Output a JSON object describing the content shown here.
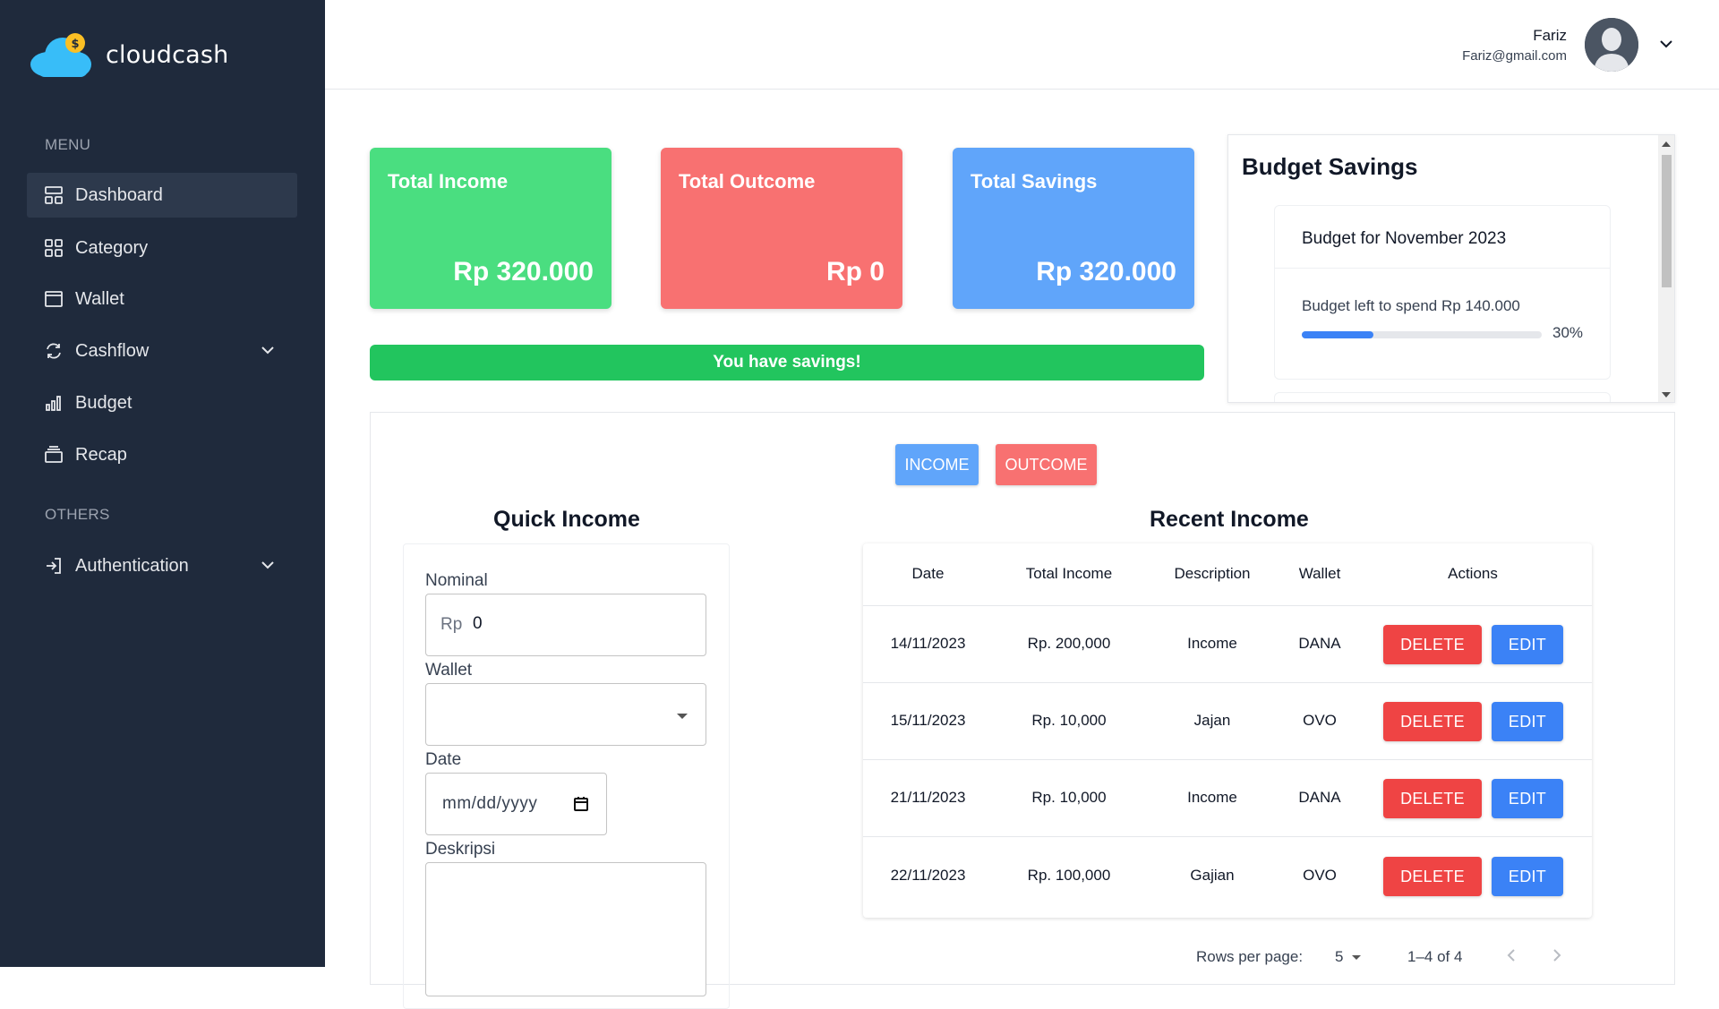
{
  "app": {
    "name": "cloudcash"
  },
  "sidebar": {
    "menu_heading": "MENU",
    "others_heading": "OTHERS",
    "items": [
      {
        "label": "Dashboard",
        "icon": "dashboard-icon"
      },
      {
        "label": "Category",
        "icon": "grid-icon"
      },
      {
        "label": "Wallet",
        "icon": "wallet-icon"
      },
      {
        "label": "Cashflow",
        "icon": "refresh-icon"
      },
      {
        "label": "Budget",
        "icon": "bar-chart-icon"
      },
      {
        "label": "Recap",
        "icon": "archive-icon"
      }
    ],
    "auth_label": "Authentication"
  },
  "header": {
    "user_name": "Fariz",
    "user_email": "Fariz@gmail.com"
  },
  "cards": {
    "income": {
      "title": "Total Income",
      "value": "Rp 320.000"
    },
    "outcome": {
      "title": "Total Outcome",
      "value": "Rp 0"
    },
    "savings": {
      "title": "Total Savings",
      "value": "Rp 320.000"
    }
  },
  "savings_message": "You have savings!",
  "budget": {
    "title": "Budget Savings",
    "card_title": "Budget for November 2023",
    "left_text": "Budget left to spend Rp 140.000",
    "progress_percent": 30,
    "progress_label": "30%"
  },
  "toggle": {
    "income_label": "INCOME",
    "outcome_label": "OUTCOME"
  },
  "quick_form": {
    "title": "Quick Income",
    "nominal_label": "Nominal",
    "nominal_prefix": "Rp",
    "nominal_value": "0",
    "wallet_label": "Wallet",
    "date_label": "Date",
    "date_placeholder": "mm/dd/yyyy",
    "desc_label": "Deskripsi"
  },
  "recent": {
    "title": "Recent Income",
    "columns": [
      "Date",
      "Total Income",
      "Description",
      "Wallet",
      "Actions"
    ],
    "rows": [
      {
        "date": "14/11/2023",
        "total": "Rp. 200,000",
        "description": "Income",
        "wallet": "DANA"
      },
      {
        "date": "15/11/2023",
        "total": "Rp. 10,000",
        "description": "Jajan",
        "wallet": "OVO"
      },
      {
        "date": "21/11/2023",
        "total": "Rp. 10,000",
        "description": "Income",
        "wallet": "DANA"
      },
      {
        "date": "22/11/2023",
        "total": "Rp. 100,000",
        "description": "Gajian",
        "wallet": "OVO"
      }
    ],
    "delete_label": "DELETE",
    "edit_label": "EDIT",
    "rows_per_page_label": "Rows per page:",
    "rows_per_page_value": "5",
    "range_label": "1–4 of 4"
  },
  "colors": {
    "sidebar": "#1f2a3c",
    "income": "#4ade80",
    "outcome": "#f87171",
    "savings": "#60a5fa",
    "success": "#22c55e"
  }
}
